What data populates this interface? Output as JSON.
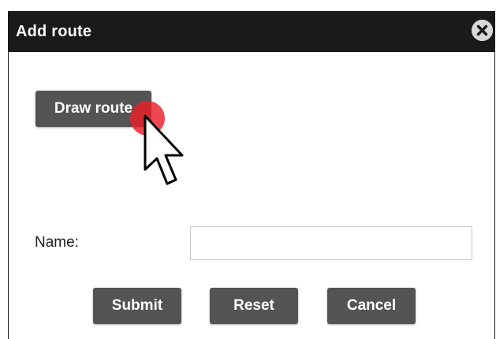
{
  "dialog": {
    "title": "Add route",
    "close_icon": "close-circle-icon",
    "draw_route_label": "Draw route",
    "name_label": "Name:",
    "name_value": "",
    "name_placeholder": "",
    "buttons": {
      "submit": "Submit",
      "reset": "Reset",
      "cancel": "Cancel"
    }
  },
  "overlay": {
    "click_marker_color": "#eb1e28",
    "cursor_icon": "arrow-cursor-icon"
  },
  "colors": {
    "titlebar": "#1a1a1a",
    "button": "#545454",
    "close_button": "#d8d8d8"
  }
}
